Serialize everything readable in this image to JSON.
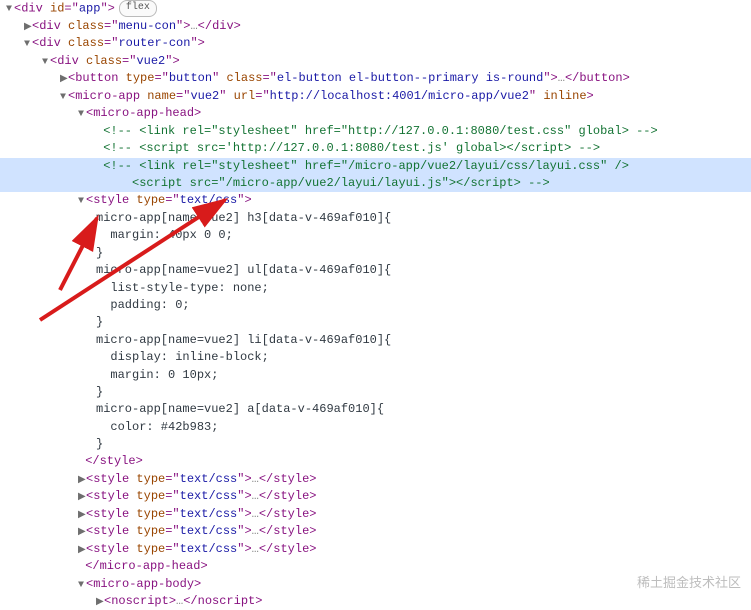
{
  "badge": "flex",
  "watermark": "稀土掘金技术社区",
  "lines": {
    "l1": {
      "tag": "div",
      "attr": "id",
      "val": "app"
    },
    "l2": {
      "tag": "div",
      "attr": "class",
      "val": "menu-con"
    },
    "l3": {
      "tag": "div",
      "attr": "class",
      "val": "router-con"
    },
    "l4": {
      "tag": "div",
      "attr": "class",
      "val": "vue2"
    },
    "l5": {
      "tag": "button",
      "a1n": "type",
      "a1v": "button",
      "a2n": "class",
      "a2v": "el-button el-button--primary is-round"
    },
    "l6": {
      "tag": "micro-app",
      "a1n": "name",
      "a1v": "vue2",
      "a2n": "url",
      "a2v": "http://localhost:4001/micro-app/vue2",
      "a3n": "inline"
    },
    "l7": {
      "tag": "micro-app-head"
    },
    "l8": "<!-- <link rel=\"stylesheet\" href=\"http://127.0.0.1:8080/test.css\" global> -->",
    "l9": "<!-- <script src='http://127.0.0.1:8080/test.js' global></script> -->",
    "l10": "<!-- <link rel=\"stylesheet\" href=\"/micro-app/vue2/layui/css/layui.css\" />",
    "l11": "    <script src=\"/micro-app/vue2/layui/layui.js\"></script> -->",
    "l12": {
      "tag": "style",
      "a1n": "type",
      "a1v": "text/css"
    },
    "css1": "micro-app[name=vue2] h3[data-v-469af010]{",
    "css2": "  margin: 40px 0 0;",
    "css3": "}",
    "css4": "micro-app[name=vue2] ul[data-v-469af010]{",
    "css5": "  list-style-type: none;",
    "css6": "  padding: 0;",
    "css7": "}",
    "css8": "micro-app[name=vue2] li[data-v-469af010]{",
    "css9": "  display: inline-block;",
    "css10": "  margin: 0 10px;",
    "css11": "}",
    "css12": "micro-app[name=vue2] a[data-v-469af010]{",
    "css13": "  color: #42b983;",
    "css14": "}",
    "styleClose": "</style>",
    "styleCollapsed": {
      "tag": "style",
      "a1n": "type",
      "a1v": "text/css"
    },
    "mahClose": "</micro-app-head>",
    "mab": {
      "tag": "micro-app-body"
    },
    "noscript": {
      "tag": "noscript"
    }
  }
}
